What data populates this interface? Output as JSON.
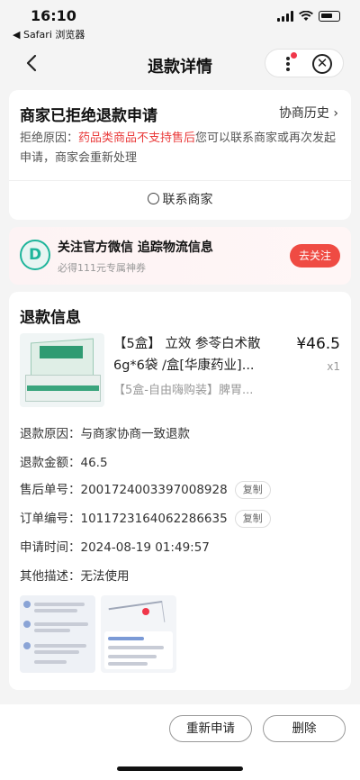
{
  "status_bar": {
    "time": "16:10",
    "back_app": "◀ Safari 浏览器"
  },
  "nav": {
    "title": "退款详情",
    "has_notification_dot": true
  },
  "reject_card": {
    "title": "商家已拒绝退款申请",
    "history_link": "协商历史 ›",
    "reason_prefix": "拒绝原因：",
    "reason_highlight": "药品类商品不支持售后",
    "reason_rest": "您可以联系商家或再次发起申请，商家会重新处理",
    "contact_button": "联系商家"
  },
  "follow_card": {
    "title": "关注官方微信 追踪物流信息",
    "subtitle": "必得111元专属神券",
    "button": "去关注"
  },
  "refund_info": {
    "title": "退款信息",
    "product": {
      "name": "【5盒】 立效 参苓白术散6g*6袋 /盒[华康药业]...",
      "spec": "【5盒-自由嗨购装】脾胃...",
      "price": "¥46.5",
      "quantity": "x1"
    },
    "rows": [
      {
        "label": "退款原因：",
        "value": "与商家协商一致退款"
      },
      {
        "label": "退款金额：",
        "value": "46.5"
      },
      {
        "label": "售后单号：",
        "value": "2001724003397008928",
        "copy": "复制"
      },
      {
        "label": "订单编号：",
        "value": "1011723164062286635",
        "copy": "复制"
      },
      {
        "label": "申请时间：",
        "value": "2024-08-19 01:49:57"
      },
      {
        "label": "其他描述：",
        "value": "无法使用"
      }
    ],
    "attachments": [
      "chat-screenshot",
      "logistics-screenshot"
    ]
  },
  "bottom_bar": {
    "reapply_button": "重新申请",
    "delete_button": "删除"
  },
  "colors": {
    "accent_red": "#ea3b3b",
    "follow_button": "#ef4b43",
    "logo_green": "#1fb59b"
  }
}
